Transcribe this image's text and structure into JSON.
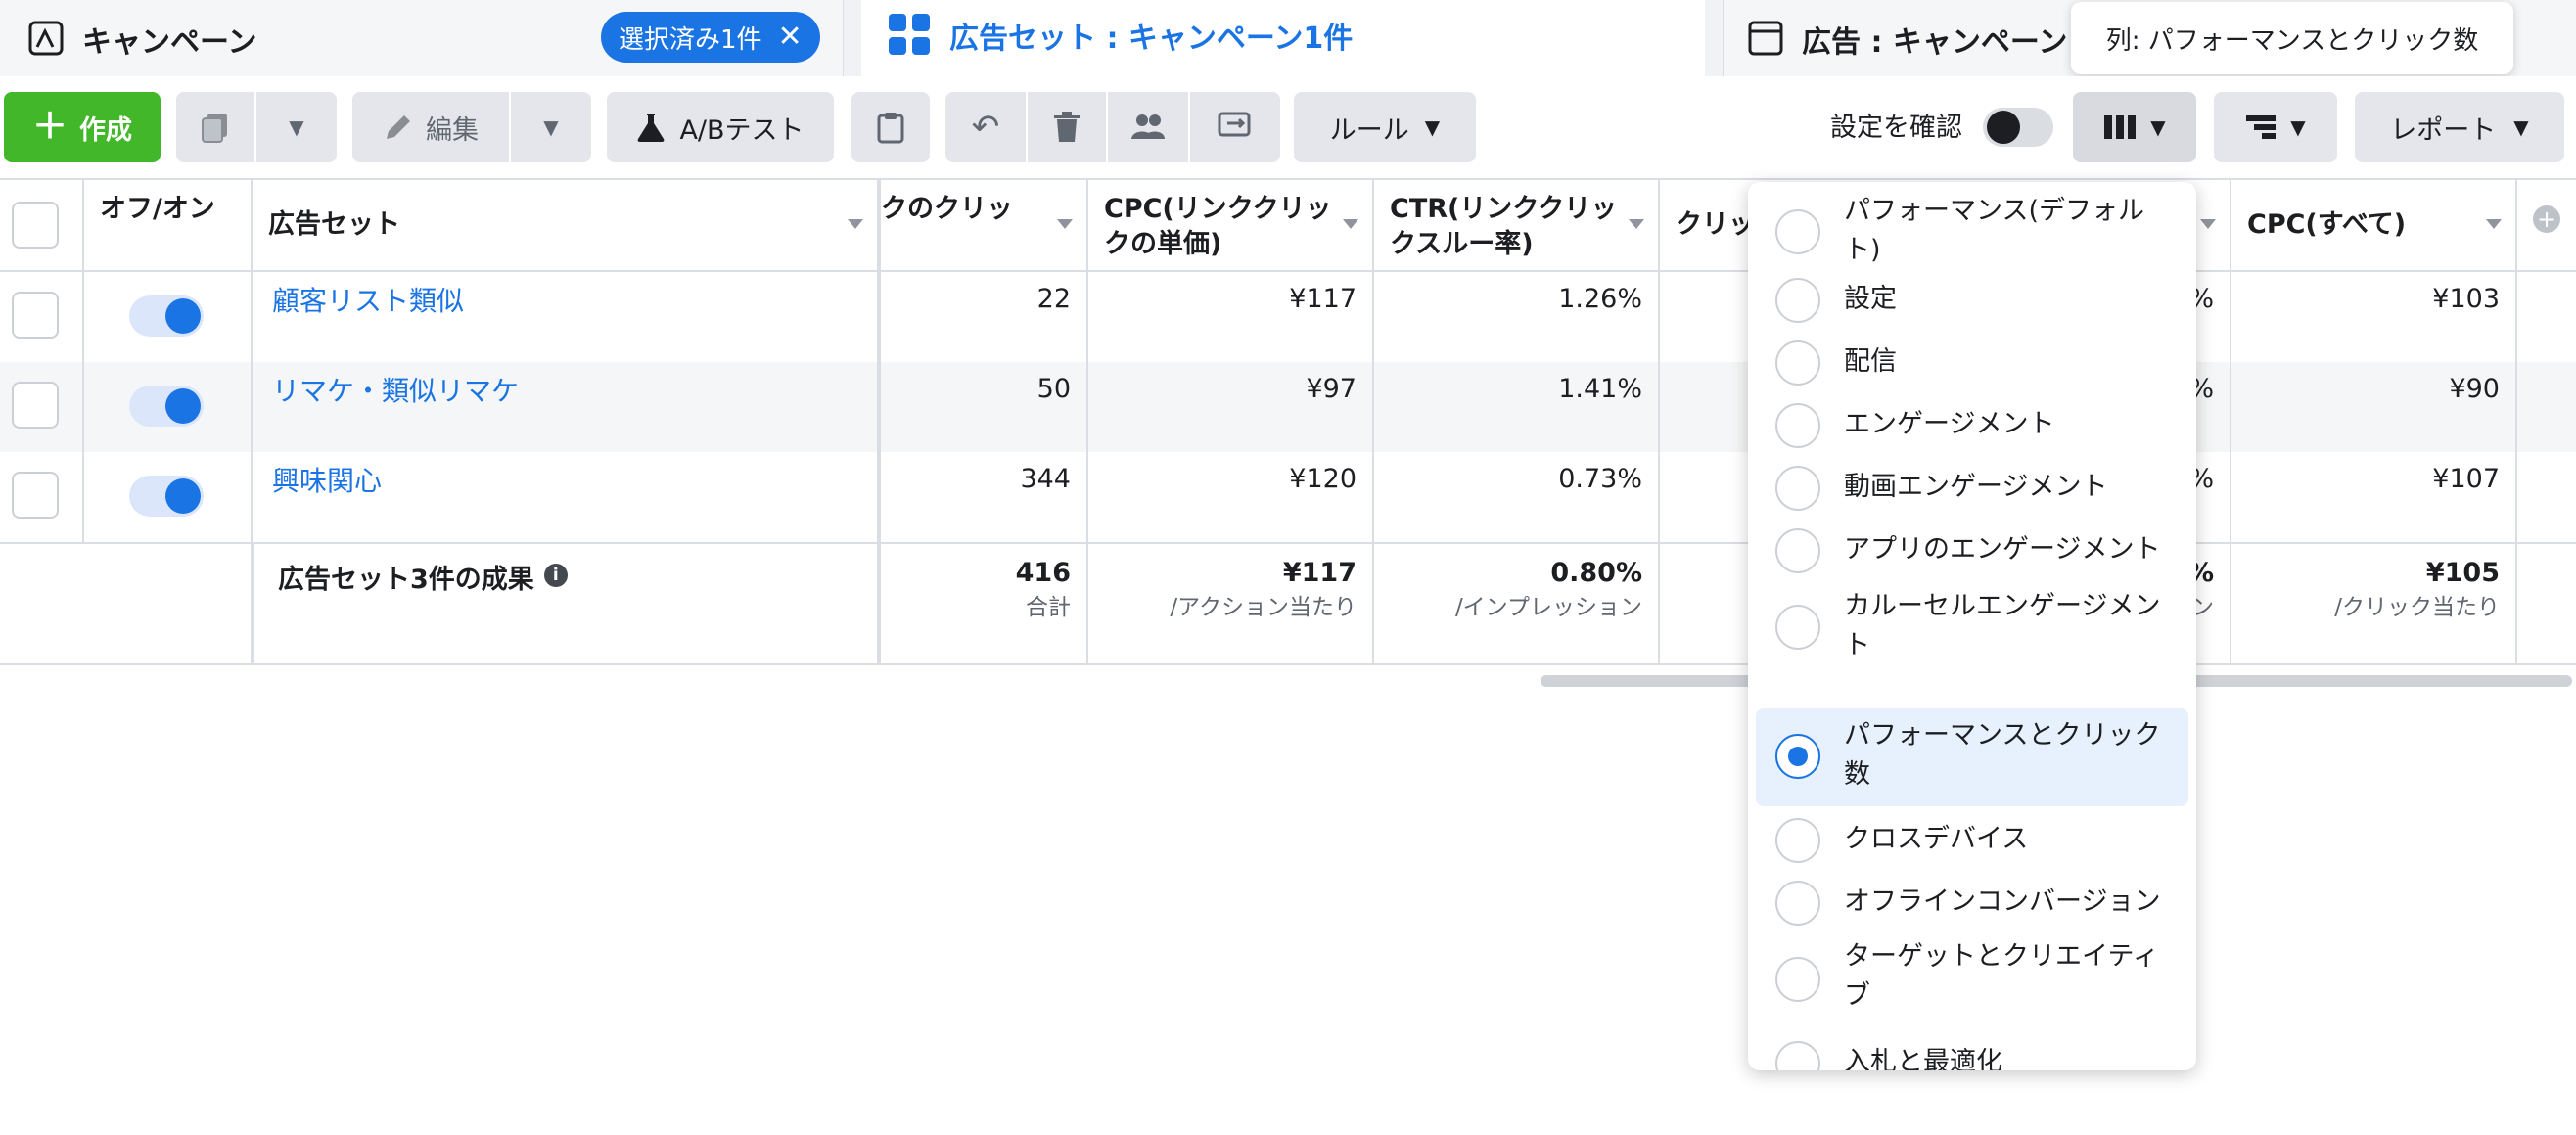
{
  "tabs": {
    "campaign": {
      "title": "キャンペーン",
      "selected_pill": "選択済み1件"
    },
    "adset": {
      "title": "広告セット : キャンペーン1件"
    },
    "ad": {
      "title": "広告 : キャンペーン"
    }
  },
  "tooltip": "列: パフォーマンスとクリック数",
  "toolbar": {
    "create_label": "作成",
    "edit_label": "編集",
    "ab_test_label": "A/Bテスト",
    "rules_label": "ルール",
    "review_settings_label": "設定を確認",
    "report_label": "レポート"
  },
  "table": {
    "headers": {
      "toggle": "オフ/オン",
      "adset": "広告セット",
      "link_clicks": "クのクリッ",
      "cpc_link": "CPC(リンククリックの単価)",
      "ctr_link": "CTR(リンククリックスルー率)",
      "clicks": "クリッ",
      "cpc_all": "CPC(すべて)"
    },
    "rows": [
      {
        "name": "顧客リスト類似",
        "link_clicks": "22",
        "cpc_link": "¥117",
        "ctr_link": "1.26%",
        "partial": "%",
        "cpc_all": "¥103"
      },
      {
        "name": "リマケ・類似リマケ",
        "link_clicks": "50",
        "cpc_link": "¥97",
        "ctr_link": "1.41%",
        "partial": "%",
        "cpc_all": "¥90"
      },
      {
        "name": "興味関心",
        "link_clicks": "344",
        "cpc_link": "¥120",
        "ctr_link": "0.73%",
        "partial": "%",
        "cpc_all": "¥107"
      }
    ],
    "summary": {
      "label": "広告セット3件の成果",
      "link_clicks": "416",
      "link_clicks_sub": "合計",
      "cpc_link": "¥117",
      "cpc_link_sub": "/アクション当たり",
      "ctr_link": "0.80%",
      "ctr_link_sub": "/インプレッション",
      "partial": "%",
      "partial_sub": "ン",
      "cpc_all": "¥105",
      "cpc_all_sub": "/クリック当たり"
    }
  },
  "column_presets": {
    "selected": "パフォーマンスとクリック数",
    "options": [
      "パフォーマンス(デフォルト)",
      "設定",
      "配信",
      "エンゲージメント",
      "動画エンゲージメント",
      "アプリのエンゲージメント",
      "カルーセルエンゲージメント",
      "パフォーマンスとクリック数",
      "クロスデバイス",
      "オフラインコンバージョン",
      "ターゲットとクリエイティブ",
      "入札と最適化"
    ]
  },
  "colors": {
    "accent": "#1b74e4",
    "create_green": "#42b72a",
    "border": "#dadde1"
  }
}
